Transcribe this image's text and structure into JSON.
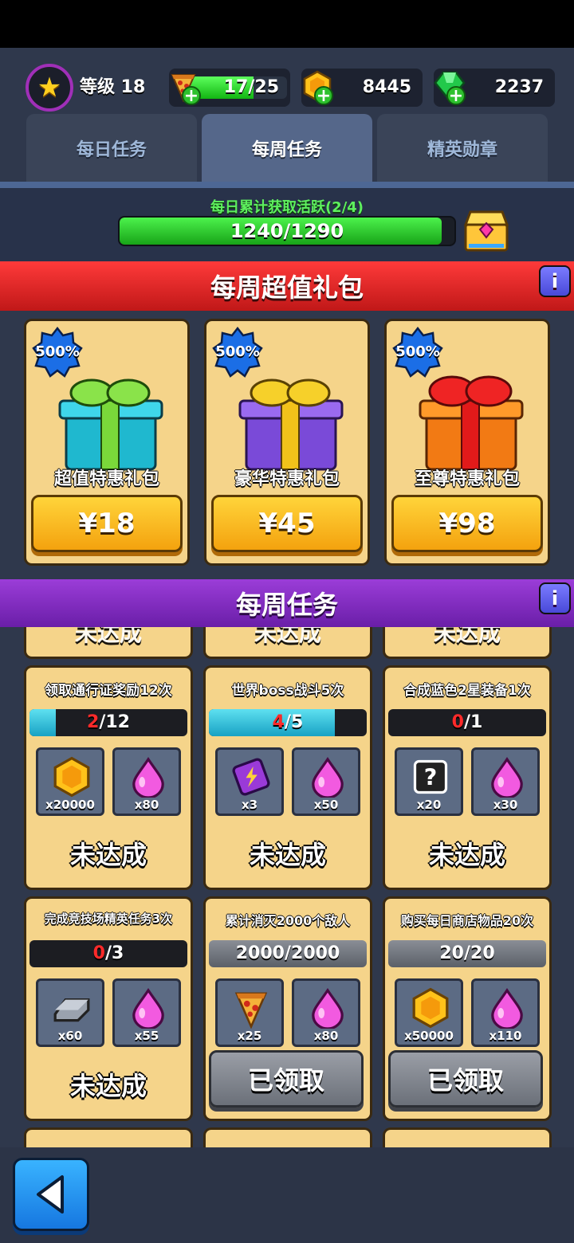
{
  "header": {
    "level_label": "等级 18",
    "energy": "17/25",
    "energy_progress": 0.68,
    "gold": "8445",
    "gems": "2237"
  },
  "tabs": [
    {
      "label": "每日任务",
      "active": false
    },
    {
      "label": "每周任务",
      "active": true
    },
    {
      "label": "精英勋章",
      "active": false
    }
  ],
  "activity": {
    "title": "每日累计获取活跃(2/4)",
    "value": "1240/1290",
    "progress": 0.961
  },
  "packs_section": {
    "title": "每周超值礼包",
    "info": "i",
    "packs": [
      {
        "badge": "500%",
        "name": "超值特惠礼包",
        "price": "¥18",
        "color": "teal"
      },
      {
        "badge": "500%",
        "name": "豪华特惠礼包",
        "price": "¥45",
        "color": "purple"
      },
      {
        "badge": "500%",
        "name": "至尊特惠礼包",
        "price": "¥98",
        "color": "orange"
      }
    ]
  },
  "tasks_section": {
    "title": "每周任务",
    "info": "i",
    "partial_status": "未达成",
    "tasks": [
      {
        "title": "领取通行证奖励12次",
        "current": "2",
        "total": "/12",
        "progress": 0.167,
        "done": false,
        "rewards": [
          {
            "icon": "gold-coin-icon",
            "qty": "x20000"
          },
          {
            "icon": "pink-drop-icon",
            "qty": "x80"
          }
        ],
        "status": "未达成"
      },
      {
        "title": "世界boss战斗5次",
        "current": "4",
        "total": "/5",
        "progress": 0.8,
        "done": false,
        "rewards": [
          {
            "icon": "ticket-icon",
            "qty": "x3"
          },
          {
            "icon": "pink-drop-icon",
            "qty": "x50"
          }
        ],
        "status": "未达成"
      },
      {
        "title": "合成蓝色2星装备1次",
        "current": "0",
        "total": "/1",
        "progress": 0,
        "done": false,
        "rewards": [
          {
            "icon": "mystery-box-icon",
            "qty": "x20"
          },
          {
            "icon": "pink-drop-icon",
            "qty": "x30"
          }
        ],
        "status": "未达成"
      },
      {
        "title": "完成竞技场精英任务3次",
        "current": "0",
        "total": "/3",
        "progress": 0,
        "done": false,
        "rewards": [
          {
            "icon": "iron-bar-icon",
            "qty": "x60"
          },
          {
            "icon": "pink-drop-icon",
            "qty": "x55"
          }
        ],
        "status": "未达成"
      },
      {
        "title": "累计消灭2000个敌人",
        "current": "",
        "total": "2000/2000",
        "progress": 1,
        "done": true,
        "rewards": [
          {
            "icon": "pizza-icon",
            "qty": "x25"
          },
          {
            "icon": "pink-drop-icon",
            "qty": "x80"
          }
        ],
        "status": "已领取"
      },
      {
        "title": "购买每日商店物品20次",
        "current": "",
        "total": "20/20",
        "progress": 1,
        "done": true,
        "rewards": [
          {
            "icon": "gold-coin-icon",
            "qty": "x50000"
          },
          {
            "icon": "pink-drop-icon",
            "qty": "x110"
          }
        ],
        "status": "已领取"
      }
    ]
  },
  "colors": {
    "accent_red": "#e02424",
    "accent_purple": "#8a31c8",
    "card_bg": "#f5d48a",
    "progress_green": "#2ecc2e",
    "progress_cyan": "#2bb8d8"
  }
}
